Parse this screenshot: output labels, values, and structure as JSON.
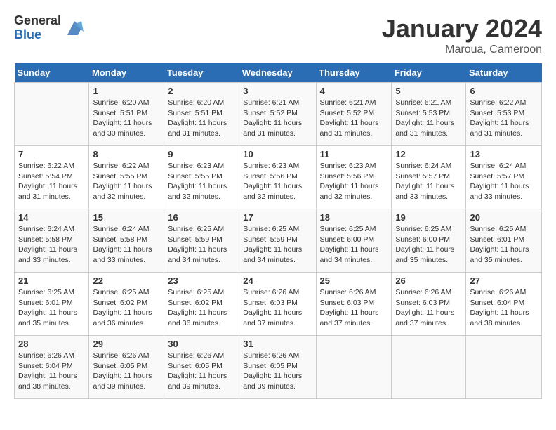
{
  "logo": {
    "general": "General",
    "blue": "Blue"
  },
  "title": "January 2024",
  "subtitle": "Maroua, Cameroon",
  "weekdays": [
    "Sunday",
    "Monday",
    "Tuesday",
    "Wednesday",
    "Thursday",
    "Friday",
    "Saturday"
  ],
  "weeks": [
    [
      {
        "day": "",
        "info": ""
      },
      {
        "day": "1",
        "info": "Sunrise: 6:20 AM\nSunset: 5:51 PM\nDaylight: 11 hours and 30 minutes."
      },
      {
        "day": "2",
        "info": "Sunrise: 6:20 AM\nSunset: 5:51 PM\nDaylight: 11 hours and 31 minutes."
      },
      {
        "day": "3",
        "info": "Sunrise: 6:21 AM\nSunset: 5:52 PM\nDaylight: 11 hours and 31 minutes."
      },
      {
        "day": "4",
        "info": "Sunrise: 6:21 AM\nSunset: 5:52 PM\nDaylight: 11 hours and 31 minutes."
      },
      {
        "day": "5",
        "info": "Sunrise: 6:21 AM\nSunset: 5:53 PM\nDaylight: 11 hours and 31 minutes."
      },
      {
        "day": "6",
        "info": "Sunrise: 6:22 AM\nSunset: 5:53 PM\nDaylight: 11 hours and 31 minutes."
      }
    ],
    [
      {
        "day": "7",
        "info": "Sunrise: 6:22 AM\nSunset: 5:54 PM\nDaylight: 11 hours and 31 minutes."
      },
      {
        "day": "8",
        "info": "Sunrise: 6:22 AM\nSunset: 5:55 PM\nDaylight: 11 hours and 32 minutes."
      },
      {
        "day": "9",
        "info": "Sunrise: 6:23 AM\nSunset: 5:55 PM\nDaylight: 11 hours and 32 minutes."
      },
      {
        "day": "10",
        "info": "Sunrise: 6:23 AM\nSunset: 5:56 PM\nDaylight: 11 hours and 32 minutes."
      },
      {
        "day": "11",
        "info": "Sunrise: 6:23 AM\nSunset: 5:56 PM\nDaylight: 11 hours and 32 minutes."
      },
      {
        "day": "12",
        "info": "Sunrise: 6:24 AM\nSunset: 5:57 PM\nDaylight: 11 hours and 33 minutes."
      },
      {
        "day": "13",
        "info": "Sunrise: 6:24 AM\nSunset: 5:57 PM\nDaylight: 11 hours and 33 minutes."
      }
    ],
    [
      {
        "day": "14",
        "info": "Sunrise: 6:24 AM\nSunset: 5:58 PM\nDaylight: 11 hours and 33 minutes."
      },
      {
        "day": "15",
        "info": "Sunrise: 6:24 AM\nSunset: 5:58 PM\nDaylight: 11 hours and 33 minutes."
      },
      {
        "day": "16",
        "info": "Sunrise: 6:25 AM\nSunset: 5:59 PM\nDaylight: 11 hours and 34 minutes."
      },
      {
        "day": "17",
        "info": "Sunrise: 6:25 AM\nSunset: 5:59 PM\nDaylight: 11 hours and 34 minutes."
      },
      {
        "day": "18",
        "info": "Sunrise: 6:25 AM\nSunset: 6:00 PM\nDaylight: 11 hours and 34 minutes."
      },
      {
        "day": "19",
        "info": "Sunrise: 6:25 AM\nSunset: 6:00 PM\nDaylight: 11 hours and 35 minutes."
      },
      {
        "day": "20",
        "info": "Sunrise: 6:25 AM\nSunset: 6:01 PM\nDaylight: 11 hours and 35 minutes."
      }
    ],
    [
      {
        "day": "21",
        "info": "Sunrise: 6:25 AM\nSunset: 6:01 PM\nDaylight: 11 hours and 35 minutes."
      },
      {
        "day": "22",
        "info": "Sunrise: 6:25 AM\nSunset: 6:02 PM\nDaylight: 11 hours and 36 minutes."
      },
      {
        "day": "23",
        "info": "Sunrise: 6:25 AM\nSunset: 6:02 PM\nDaylight: 11 hours and 36 minutes."
      },
      {
        "day": "24",
        "info": "Sunrise: 6:26 AM\nSunset: 6:03 PM\nDaylight: 11 hours and 37 minutes."
      },
      {
        "day": "25",
        "info": "Sunrise: 6:26 AM\nSunset: 6:03 PM\nDaylight: 11 hours and 37 minutes."
      },
      {
        "day": "26",
        "info": "Sunrise: 6:26 AM\nSunset: 6:03 PM\nDaylight: 11 hours and 37 minutes."
      },
      {
        "day": "27",
        "info": "Sunrise: 6:26 AM\nSunset: 6:04 PM\nDaylight: 11 hours and 38 minutes."
      }
    ],
    [
      {
        "day": "28",
        "info": "Sunrise: 6:26 AM\nSunset: 6:04 PM\nDaylight: 11 hours and 38 minutes."
      },
      {
        "day": "29",
        "info": "Sunrise: 6:26 AM\nSunset: 6:05 PM\nDaylight: 11 hours and 39 minutes."
      },
      {
        "day": "30",
        "info": "Sunrise: 6:26 AM\nSunset: 6:05 PM\nDaylight: 11 hours and 39 minutes."
      },
      {
        "day": "31",
        "info": "Sunrise: 6:26 AM\nSunset: 6:05 PM\nDaylight: 11 hours and 39 minutes."
      },
      {
        "day": "",
        "info": ""
      },
      {
        "day": "",
        "info": ""
      },
      {
        "day": "",
        "info": ""
      }
    ]
  ]
}
